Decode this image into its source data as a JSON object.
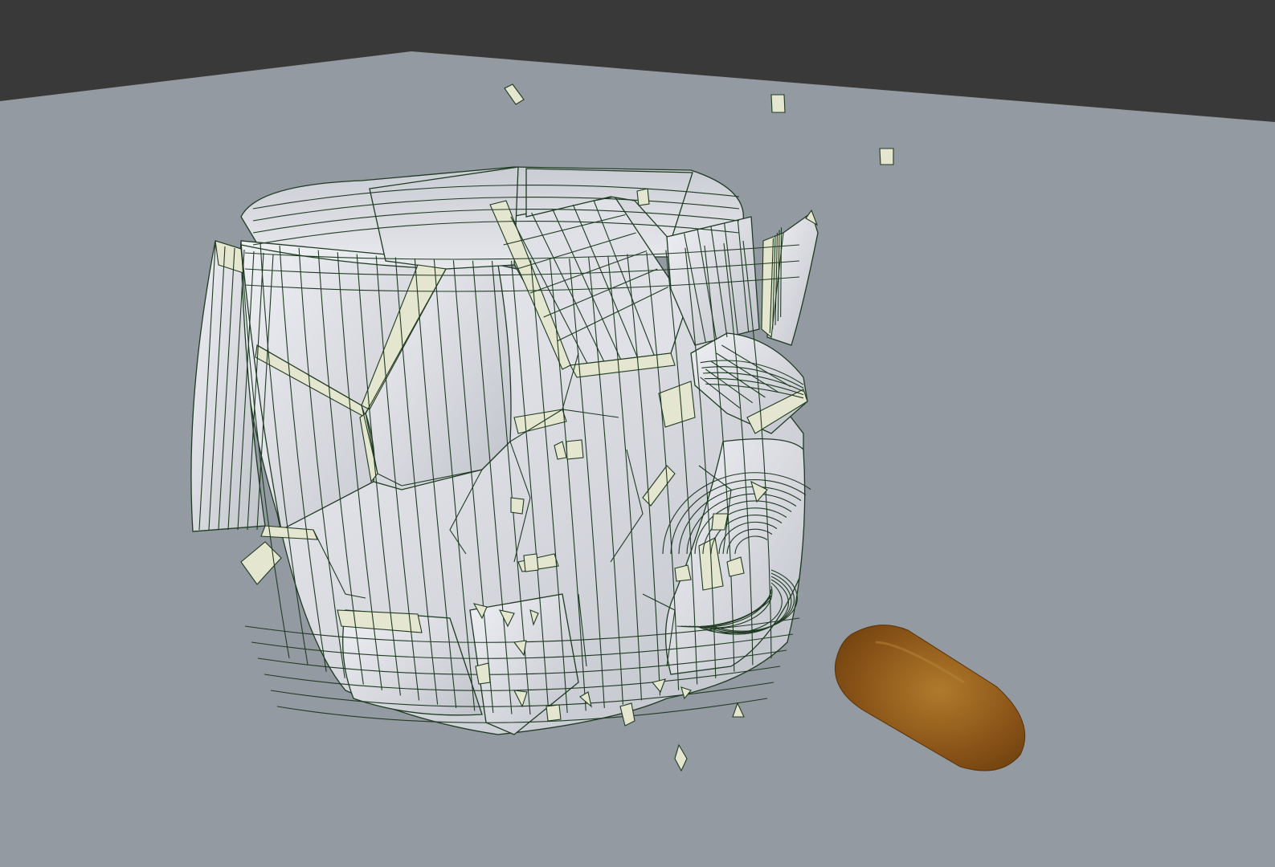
{
  "viewport": {
    "kind": "3d-viewport",
    "scene": "shattered-cup-wireframe-with-bullet"
  },
  "colors": {
    "background_top": "#393939",
    "floor": "#949aa1",
    "fragment_face": "#dcdde2",
    "fragment_edge": "#e5e6cf",
    "wireframe": "#1f3a22",
    "bullet": "#8a5418"
  },
  "objects": [
    {
      "name": "shattered-cup",
      "icon": "mesh-object"
    },
    {
      "name": "bullet",
      "icon": "mesh-object"
    },
    {
      "name": "floor-plane",
      "icon": "mesh-object"
    }
  ]
}
